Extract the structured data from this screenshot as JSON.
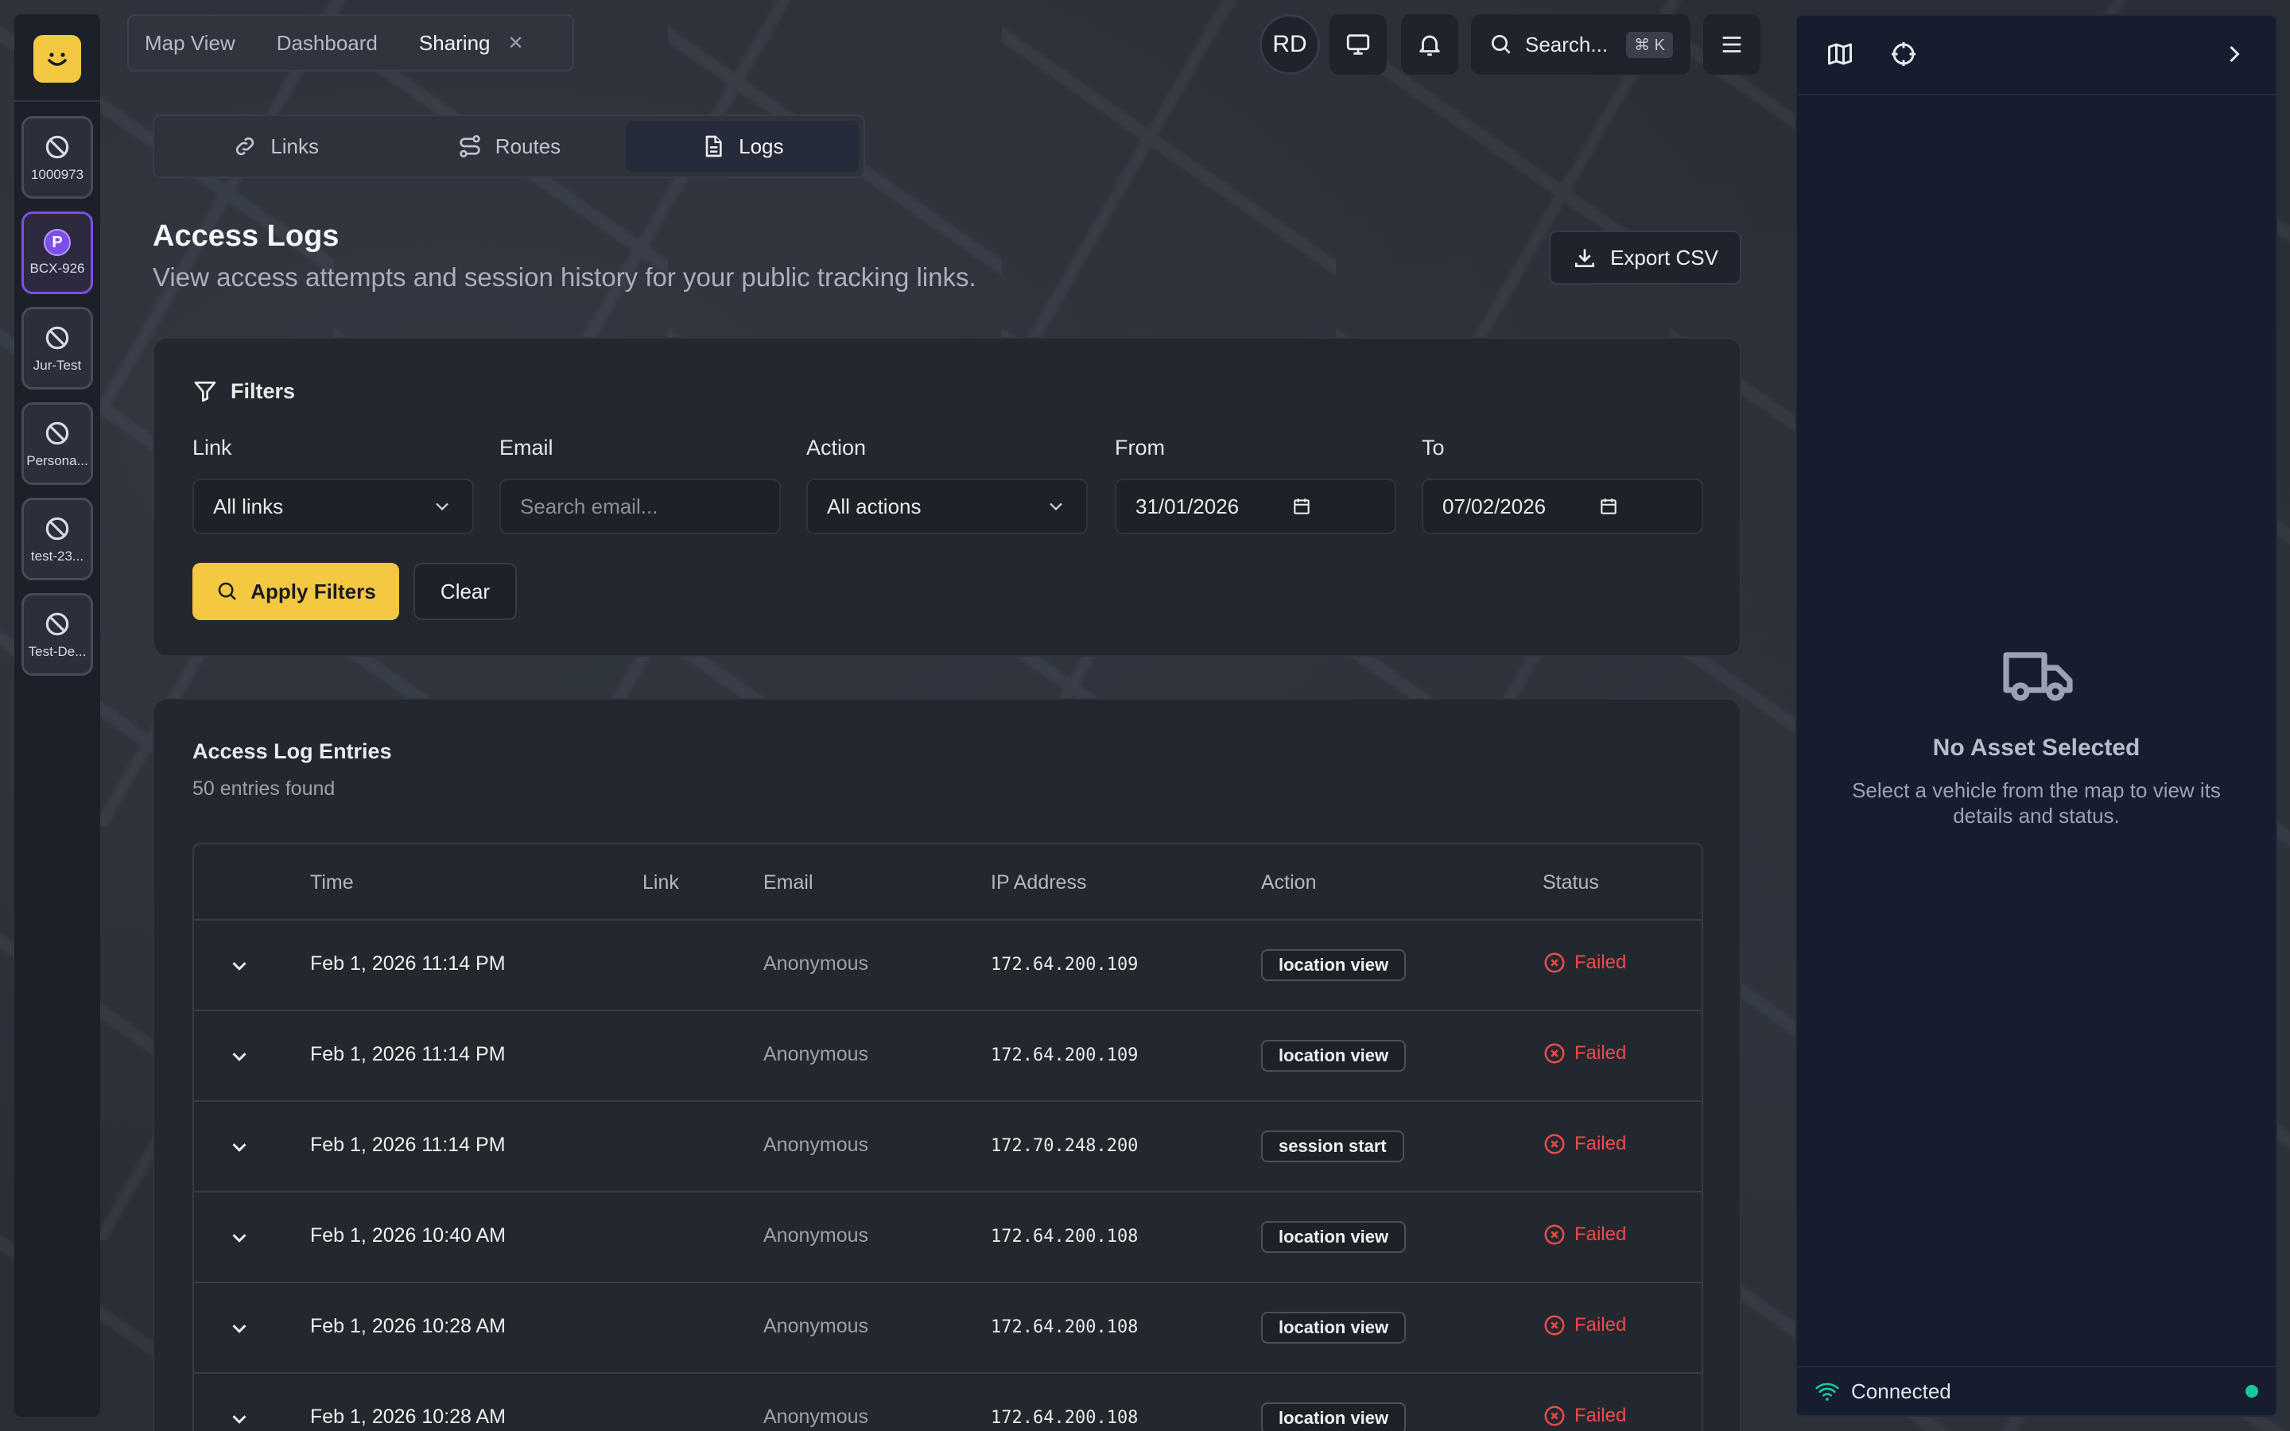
{
  "top_tabs": [
    {
      "label": "Map View"
    },
    {
      "label": "Dashboard"
    },
    {
      "label": "Sharing"
    }
  ],
  "header": {
    "avatar_initials": "RD",
    "search_label": "Search...",
    "search_shortcut": "⌘ K"
  },
  "assets": [
    {
      "label": "1000973",
      "icon": "no-signal-icon"
    },
    {
      "label": "BCX-926",
      "icon": "parking-icon",
      "active": true
    },
    {
      "label": "Jur-Test",
      "icon": "no-signal-icon"
    },
    {
      "label": "Persona...",
      "icon": "no-signal-icon"
    },
    {
      "label": "test-23...",
      "icon": "no-signal-icon"
    },
    {
      "label": "Test-De...",
      "icon": "no-signal-icon"
    }
  ],
  "sub_tabs": [
    {
      "label": "Links",
      "icon": "link-icon"
    },
    {
      "label": "Routes",
      "icon": "route-icon"
    },
    {
      "label": "Logs",
      "icon": "document-icon",
      "active": true
    }
  ],
  "page": {
    "title": "Access Logs",
    "subtitle": "View access attempts and session history for your public tracking links.",
    "export_label": "Export CSV"
  },
  "filters": {
    "title": "Filters",
    "link": {
      "label": "Link",
      "value": "All links"
    },
    "email": {
      "label": "Email",
      "placeholder": "Search email..."
    },
    "action": {
      "label": "Action",
      "value": "All actions"
    },
    "from": {
      "label": "From",
      "value": "31/01/2026"
    },
    "to": {
      "label": "To",
      "value": "07/02/2026"
    },
    "apply_label": "Apply Filters",
    "clear_label": "Clear"
  },
  "logs": {
    "title": "Access Log Entries",
    "count_text": "50 entries found",
    "columns": [
      "Time",
      "Link",
      "Email",
      "IP Address",
      "Action",
      "Status"
    ],
    "rows": [
      {
        "time": "Feb 1, 2026 11:14 PM",
        "link": "",
        "email": "Anonymous",
        "ip": "172.64.200.109",
        "action": "location view",
        "status": "Failed"
      },
      {
        "time": "Feb 1, 2026 11:14 PM",
        "link": "",
        "email": "Anonymous",
        "ip": "172.64.200.109",
        "action": "location view",
        "status": "Failed"
      },
      {
        "time": "Feb 1, 2026 11:14 PM",
        "link": "",
        "email": "Anonymous",
        "ip": "172.70.248.200",
        "action": "session start",
        "status": "Failed"
      },
      {
        "time": "Feb 1, 2026 10:40 AM",
        "link": "",
        "email": "Anonymous",
        "ip": "172.64.200.108",
        "action": "location view",
        "status": "Failed"
      },
      {
        "time": "Feb 1, 2026 10:28 AM",
        "link": "",
        "email": "Anonymous",
        "ip": "172.64.200.108",
        "action": "location view",
        "status": "Failed"
      },
      {
        "time": "Feb 1, 2026 10:28 AM",
        "link": "",
        "email": "Anonymous",
        "ip": "172.64.200.108",
        "action": "location view",
        "status": "Failed"
      }
    ]
  },
  "right_panel": {
    "empty_title": "No Asset Selected",
    "empty_text": "Select a vehicle from the map to view its details and status.",
    "connection_status": "Connected"
  },
  "colors": {
    "accent": "#f5c842",
    "active_asset": "#7e4ee8",
    "failed": "#ef4b4b",
    "connected": "#16c79a"
  }
}
